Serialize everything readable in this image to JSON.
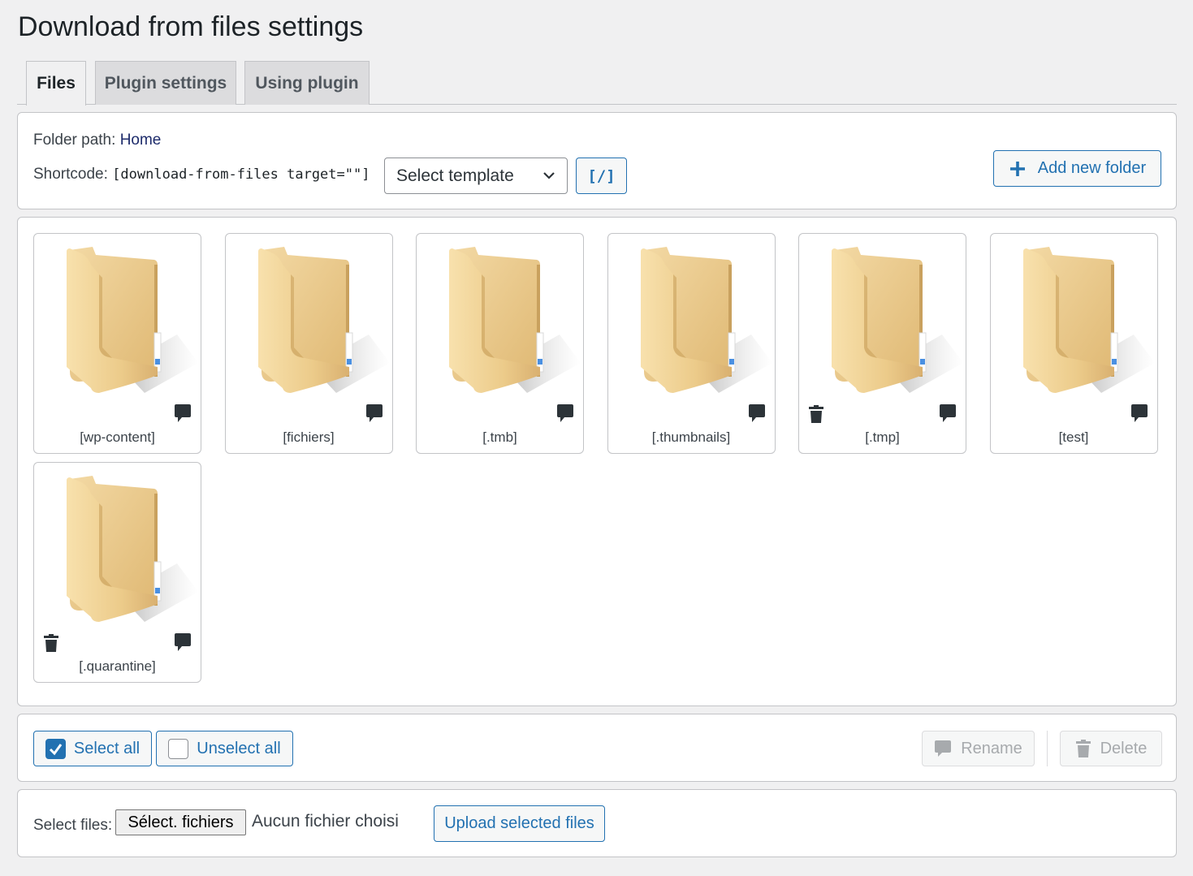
{
  "page": {
    "title": "Download from files settings"
  },
  "tabs": [
    {
      "label": "Files",
      "active": true
    },
    {
      "label": "Plugin settings",
      "active": false
    },
    {
      "label": "Using plugin",
      "active": false
    }
  ],
  "toolbar": {
    "folder_path_label": "Folder path:",
    "folder_path_link": "Home",
    "shortcode_label": "Shortcode:",
    "shortcode_value": "[download-from-files target=\"\"]",
    "template_select": {
      "selected": "Select template"
    },
    "shortcode_button": "[/]",
    "add_folder_label": "Add new folder",
    "accent_color": "#2271b1"
  },
  "folders": [
    {
      "name": "[wp-content]",
      "deletable": false
    },
    {
      "name": "[fichiers]",
      "deletable": false
    },
    {
      "name": "[.tmb]",
      "deletable": false
    },
    {
      "name": "[.thumbnails]",
      "deletable": false
    },
    {
      "name": "[.tmp]",
      "deletable": true
    },
    {
      "name": "[test]",
      "deletable": false
    },
    {
      "name": "[.quarantine]",
      "deletable": true
    }
  ],
  "selection": {
    "select_all": "Select all",
    "unselect_all": "Unselect all",
    "rename": "Rename",
    "delete": "Delete"
  },
  "upload": {
    "select_files_label": "Select files:",
    "file_button": "Sélect. fichiers",
    "no_file": "Aucun fichier choisi",
    "upload_button": "Upload selected files"
  }
}
